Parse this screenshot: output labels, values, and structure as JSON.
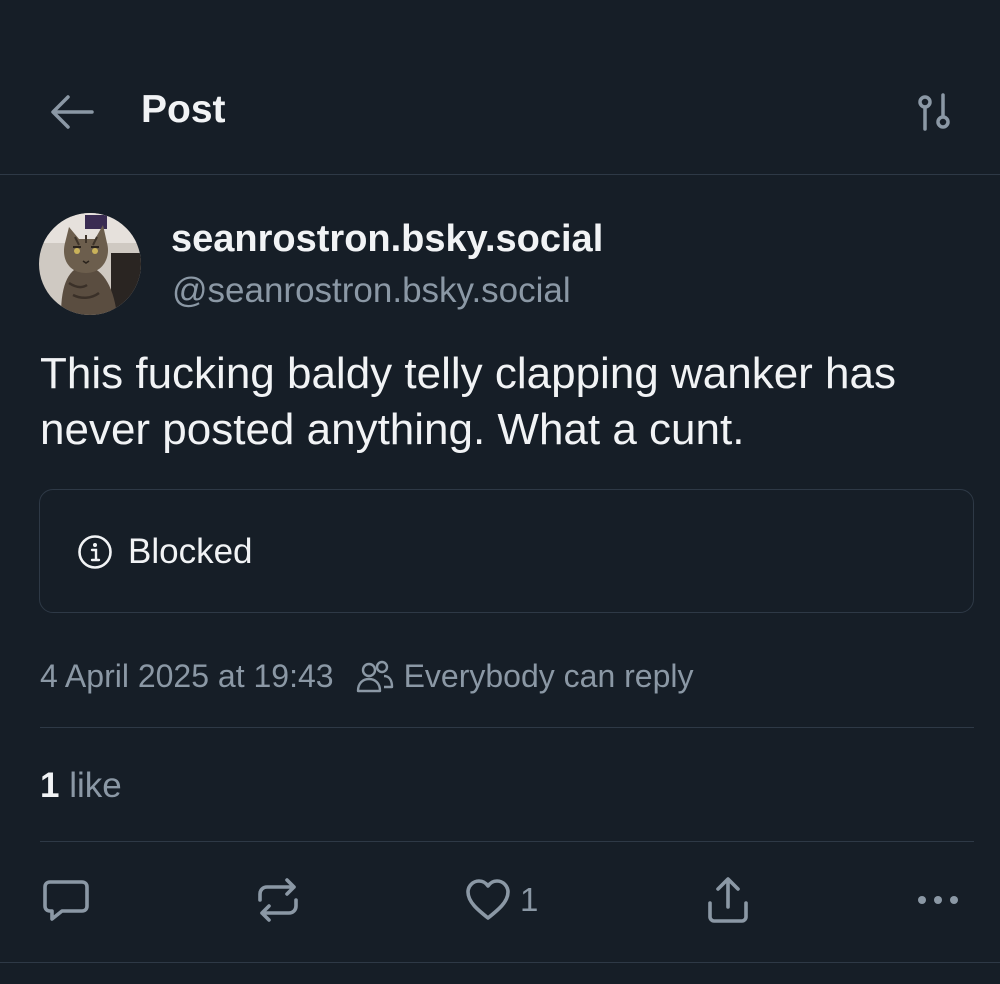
{
  "header": {
    "title": "Post"
  },
  "author": {
    "display_name": "seanrostron.bsky.social",
    "handle": "@seanrostron.bsky.social"
  },
  "post": {
    "text": "This fucking baldy telly clapping wanker has never posted anything. What a cunt.",
    "quote_notice": "Blocked",
    "timestamp": "4 April 2025 at 19:43",
    "reply_setting": "Everybody can reply"
  },
  "stats": {
    "like_count": "1",
    "like_word": "like"
  },
  "actions": {
    "like_count": "1"
  },
  "colors": {
    "background": "#161e27",
    "text_primary": "#f1f3f5",
    "text_secondary": "#8b98a5",
    "border": "#2e3946"
  },
  "icons": {
    "back": "arrow-left-icon",
    "settings": "sliders-icon",
    "info": "info-circle-icon",
    "people": "people-icon",
    "reply": "speech-bubble-icon",
    "repost": "repost-arrows-icon",
    "like": "heart-icon",
    "share": "share-upload-icon",
    "more": "ellipsis-icon"
  }
}
